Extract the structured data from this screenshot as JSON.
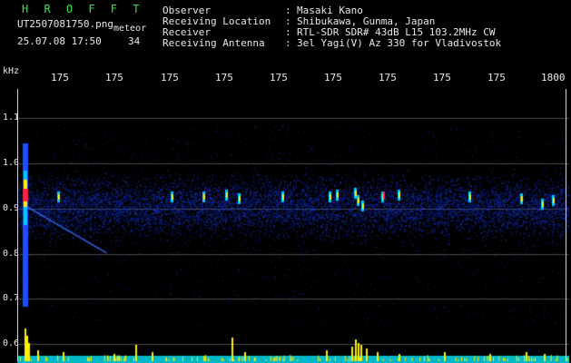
{
  "header": {
    "title": "H R O F F T",
    "filename": "UT2507081750.png",
    "tag": "meteor",
    "datetime": "25.07.08 17:50",
    "count": "34"
  },
  "info": {
    "observer_label": "Observer",
    "observer_value": "Masaki Kano",
    "location_label": "Receiving Location",
    "location_value": "Shibukawa, Gunma, Japan",
    "receiver_label": "Receiver",
    "receiver_value": "RTL-SDR SDR# 43dB L15 103.2MHz CW",
    "antenna_label": "Receiving Antenna",
    "antenna_value": "3el Yagi(V) Az 330 for Vladivostok",
    "separator": ":"
  },
  "axes": {
    "y_unit": "kHz",
    "y_ticks": [
      "1.1",
      "1.0",
      "0.9",
      "0.8",
      "0.7",
      "0.6"
    ],
    "x_ticks": [
      "175",
      "175",
      "175",
      "175",
      "175",
      "175",
      "175",
      "175",
      "175",
      "1800"
    ]
  },
  "colors": {
    "label_green": "#2ee84a",
    "text_white": "#e8e8e8",
    "background": "#000000",
    "noise_blue": "#1a2ec8",
    "echo_yellow": "#ffee00",
    "echo_red": "#ff2040",
    "baseline_cyan": "#00c8d0"
  }
}
